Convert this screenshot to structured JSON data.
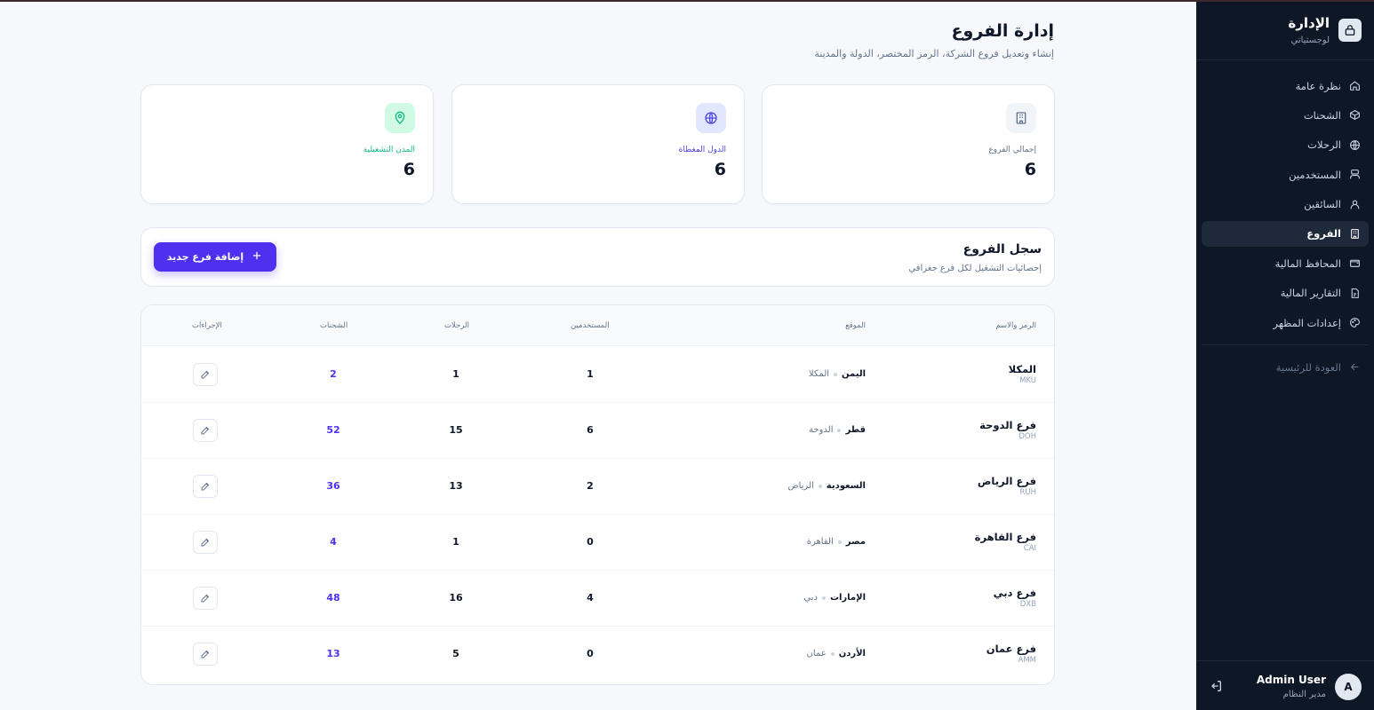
{
  "colors": {
    "accent": "#4f2ff0",
    "sidebar_bg": "#0e1726",
    "green": "#10b981",
    "indigo": "#4f46e5"
  },
  "sidebar": {
    "brand_title": "الإدارة",
    "brand_sub": "لوجستياتي",
    "items": [
      {
        "label": "نظرة عامة",
        "icon": "home-icon"
      },
      {
        "label": "الشحنات",
        "icon": "package-icon"
      },
      {
        "label": "الرحلات",
        "icon": "globe-icon"
      },
      {
        "label": "المستخدمين",
        "icon": "users-icon"
      },
      {
        "label": "السائقين",
        "icon": "user-icon"
      },
      {
        "label": "الفروع",
        "icon": "building-icon",
        "active": true
      },
      {
        "label": "المحافظ المالية",
        "icon": "wallet-icon"
      },
      {
        "label": "التقارير المالية",
        "icon": "file-icon"
      },
      {
        "label": "إعدادات المظهر",
        "icon": "palette-icon"
      }
    ],
    "back_label": "العودة للرئيسية",
    "user": {
      "initial": "A",
      "name": "Admin User",
      "role": "مدير النظام"
    }
  },
  "header": {
    "title": "إدارة الفروع",
    "subtitle": "إنشاء وتعديل فروع الشركة، الرمز المختصر، الدولة والمدينة"
  },
  "stats": [
    {
      "label": "إجمالي الفروع",
      "value": "6",
      "icon": "building-icon"
    },
    {
      "label": "الدول المغطاة",
      "value": "6",
      "icon": "globe-icon"
    },
    {
      "label": "المدن التشغيلية",
      "value": "6",
      "icon": "map-pin-icon"
    }
  ],
  "registry": {
    "title": "سجل الفروع",
    "subtitle": "إحصائيات التشغيل لكل فرع جغرافي",
    "add_button": "إضافة فرع جديد"
  },
  "table": {
    "columns": {
      "name": "الرمز والاسم",
      "location": "الموقع",
      "users": "المستخدمين",
      "trips": "الرحلات",
      "shipments": "الشحنات",
      "actions": "الإجراءات"
    },
    "rows": [
      {
        "name": "المكلا",
        "code": "MKU",
        "country": "اليمن",
        "city": "المكلا",
        "users": "1",
        "trips": "1",
        "shipments": "2"
      },
      {
        "name": "فرع الدوحة",
        "code": "DOH",
        "country": "قطر",
        "city": "الدوحة",
        "users": "6",
        "trips": "15",
        "shipments": "52"
      },
      {
        "name": "فرع الرياض",
        "code": "RUH",
        "country": "السعودية",
        "city": "الرياض",
        "users": "2",
        "trips": "13",
        "shipments": "36"
      },
      {
        "name": "فرع القاهرة",
        "code": "CAI",
        "country": "مصر",
        "city": "القاهرة",
        "users": "0",
        "trips": "1",
        "shipments": "4"
      },
      {
        "name": "فرع دبي",
        "code": "DXB",
        "country": "الإمارات",
        "city": "دبي",
        "users": "4",
        "trips": "16",
        "shipments": "48"
      },
      {
        "name": "فرع عمان",
        "code": "AMM",
        "country": "الأردن",
        "city": "عمان",
        "users": "0",
        "trips": "5",
        "shipments": "13"
      }
    ]
  }
}
